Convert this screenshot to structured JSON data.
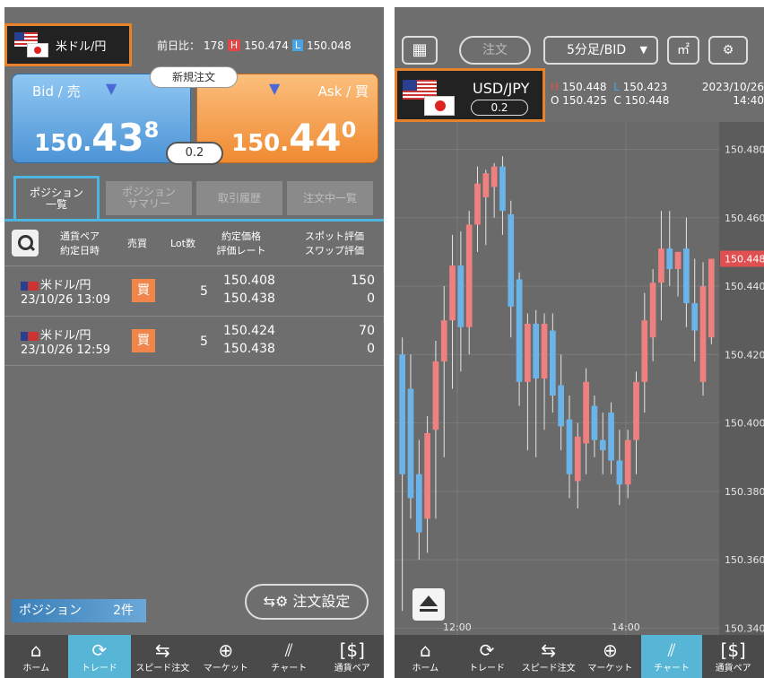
{
  "left": {
    "pair_name": "米ドル/円",
    "prev_day": {
      "label": "前日比：",
      "value": "178",
      "h_label": "H",
      "high": "150.474",
      "l_label": "L",
      "low": "150.048"
    },
    "new_order": "新規注文",
    "bid": {
      "label": "Bid / 売",
      "prefix": "150.",
      "big": "43",
      "sup": "8"
    },
    "ask": {
      "label": "Ask / 買",
      "prefix": "150.",
      "big": "44",
      "sup": "0"
    },
    "spread": "0.2",
    "tabs": [
      {
        "label": "ポジション\n一覧",
        "active": true
      },
      {
        "label": "ポジション\nサマリー",
        "active": false
      },
      {
        "label": "取引履歴",
        "active": false
      },
      {
        "label": "注文中一覧",
        "active": false
      }
    ],
    "headers": {
      "pair": "通貨ペア",
      "date": "約定日時",
      "side": "売買",
      "lot": "Lot数",
      "price": "約定価格",
      "rate": "評価レート",
      "spot": "スポット評価",
      "swap": "スワップ評価"
    },
    "rows": [
      {
        "pair": "米ドル/円",
        "date": "23/10/26 13:09",
        "side": "買",
        "lot": "5",
        "price": "150.408",
        "rate": "150.438",
        "spot": "150",
        "swap": "0"
      },
      {
        "pair": "米ドル/円",
        "date": "23/10/26 12:59",
        "side": "買",
        "lot": "5",
        "price": "150.424",
        "rate": "150.438",
        "spot": "70",
        "swap": "0"
      }
    ],
    "position_label": "ポジション",
    "position_count": "2件",
    "order_settings": "注文設定"
  },
  "right": {
    "order_button": "注文",
    "timeframe": "5分足/BID",
    "pair": "USD/JPY",
    "spread": "0.2",
    "ohlc": {
      "h_label": "H",
      "h": "150.448",
      "l_label": "L",
      "l": "150.423",
      "o_label": "O",
      "o": "150.425",
      "c_label": "C",
      "c": "150.448"
    },
    "date": "2023/10/26",
    "time": "14:40",
    "current_price": "150.448"
  },
  "nav_left": [
    {
      "label": "ホーム",
      "icon": "home-icon"
    },
    {
      "label": "トレード",
      "icon": "trade-icon",
      "active": true
    },
    {
      "label": "スピード注文",
      "icon": "speed-order-icon"
    },
    {
      "label": "マーケット",
      "icon": "globe-icon"
    },
    {
      "label": "チャート",
      "icon": "chart-icon"
    },
    {
      "label": "通貨ペア",
      "icon": "currency-icon"
    }
  ],
  "nav_right": [
    {
      "label": "ホーム",
      "icon": "home-icon"
    },
    {
      "label": "トレード",
      "icon": "trade-icon"
    },
    {
      "label": "スピード注文",
      "icon": "speed-order-icon"
    },
    {
      "label": "マーケット",
      "icon": "globe-icon"
    },
    {
      "label": "チャート",
      "icon": "chart-icon",
      "active": true
    },
    {
      "label": "通貨ペア",
      "icon": "currency-icon"
    }
  ],
  "chart_data": {
    "type": "candlestick",
    "timeframe": "5分足/BID",
    "y_ticks": [
      "150.480",
      "150.460",
      "150.440",
      "150.420",
      "150.400",
      "150.380",
      "150.360",
      "150.340"
    ],
    "x_ticks": [
      "12:00",
      "14:00"
    ],
    "ylim": [
      150.338,
      150.488
    ],
    "up_color": "#ef8080",
    "down_color": "#6ab4ea",
    "candles": [
      {
        "o": 150.42,
        "h": 150.425,
        "l": 150.345,
        "c": 150.385
      },
      {
        "o": 150.41,
        "h": 150.42,
        "l": 150.372,
        "c": 150.378
      },
      {
        "o": 150.385,
        "h": 150.395,
        "l": 150.36,
        "c": 150.368
      },
      {
        "o": 150.372,
        "h": 150.402,
        "l": 150.362,
        "c": 150.397
      },
      {
        "o": 150.398,
        "h": 150.424,
        "l": 150.372,
        "c": 150.418
      },
      {
        "o": 150.418,
        "h": 150.44,
        "l": 150.39,
        "c": 150.43
      },
      {
        "o": 150.43,
        "h": 150.455,
        "l": 150.41,
        "c": 150.446
      },
      {
        "o": 150.446,
        "h": 150.456,
        "l": 150.415,
        "c": 150.428
      },
      {
        "o": 150.428,
        "h": 150.462,
        "l": 150.42,
        "c": 150.458
      },
      {
        "o": 150.458,
        "h": 150.475,
        "l": 150.45,
        "c": 150.47
      },
      {
        "o": 150.466,
        "h": 150.474,
        "l": 150.452,
        "c": 150.473
      },
      {
        "o": 150.469,
        "h": 150.476,
        "l": 150.46,
        "c": 150.475
      },
      {
        "o": 150.475,
        "h": 150.478,
        "l": 150.455,
        "c": 150.462
      },
      {
        "o": 150.461,
        "h": 150.465,
        "l": 150.425,
        "c": 150.434
      },
      {
        "o": 150.442,
        "h": 150.444,
        "l": 150.405,
        "c": 150.412
      },
      {
        "o": 150.412,
        "h": 150.432,
        "l": 150.392,
        "c": 150.429
      },
      {
        "o": 150.429,
        "h": 150.433,
        "l": 150.39,
        "c": 150.413
      },
      {
        "o": 150.413,
        "h": 150.432,
        "l": 150.398,
        "c": 150.429
      },
      {
        "o": 150.427,
        "h": 150.432,
        "l": 150.403,
        "c": 150.408
      },
      {
        "o": 150.411,
        "h": 150.42,
        "l": 150.392,
        "c": 150.399
      },
      {
        "o": 150.401,
        "h": 150.408,
        "l": 150.378,
        "c": 150.385
      },
      {
        "o": 150.383,
        "h": 150.4,
        "l": 150.375,
        "c": 150.396
      },
      {
        "o": 150.394,
        "h": 150.416,
        "l": 150.385,
        "c": 150.412
      },
      {
        "o": 150.405,
        "h": 150.408,
        "l": 150.39,
        "c": 150.395
      },
      {
        "o": 150.395,
        "h": 150.403,
        "l": 150.385,
        "c": 150.392
      },
      {
        "o": 150.403,
        "h": 150.406,
        "l": 150.385,
        "c": 150.389
      },
      {
        "o": 150.389,
        "h": 150.398,
        "l": 150.376,
        "c": 150.382
      },
      {
        "o": 150.382,
        "h": 150.398,
        "l": 150.378,
        "c": 150.395
      },
      {
        "o": 150.395,
        "h": 150.415,
        "l": 150.385,
        "c": 150.412
      },
      {
        "o": 150.412,
        "h": 150.438,
        "l": 150.403,
        "c": 150.43
      },
      {
        "o": 150.425,
        "h": 150.445,
        "l": 150.418,
        "c": 150.441
      },
      {
        "o": 150.441,
        "h": 150.462,
        "l": 150.43,
        "c": 150.451
      },
      {
        "o": 150.451,
        "h": 150.462,
        "l": 150.44,
        "c": 150.445
      },
      {
        "o": 150.445,
        "h": 150.45,
        "l": 150.437,
        "c": 150.45
      },
      {
        "o": 150.451,
        "h": 150.46,
        "l": 150.428,
        "c": 150.435
      },
      {
        "o": 150.435,
        "h": 150.448,
        "l": 150.418,
        "c": 150.427
      },
      {
        "o": 150.412,
        "h": 150.447,
        "l": 150.408,
        "c": 150.44
      },
      {
        "o": 150.425,
        "h": 150.448,
        "l": 150.423,
        "c": 150.448
      }
    ]
  }
}
